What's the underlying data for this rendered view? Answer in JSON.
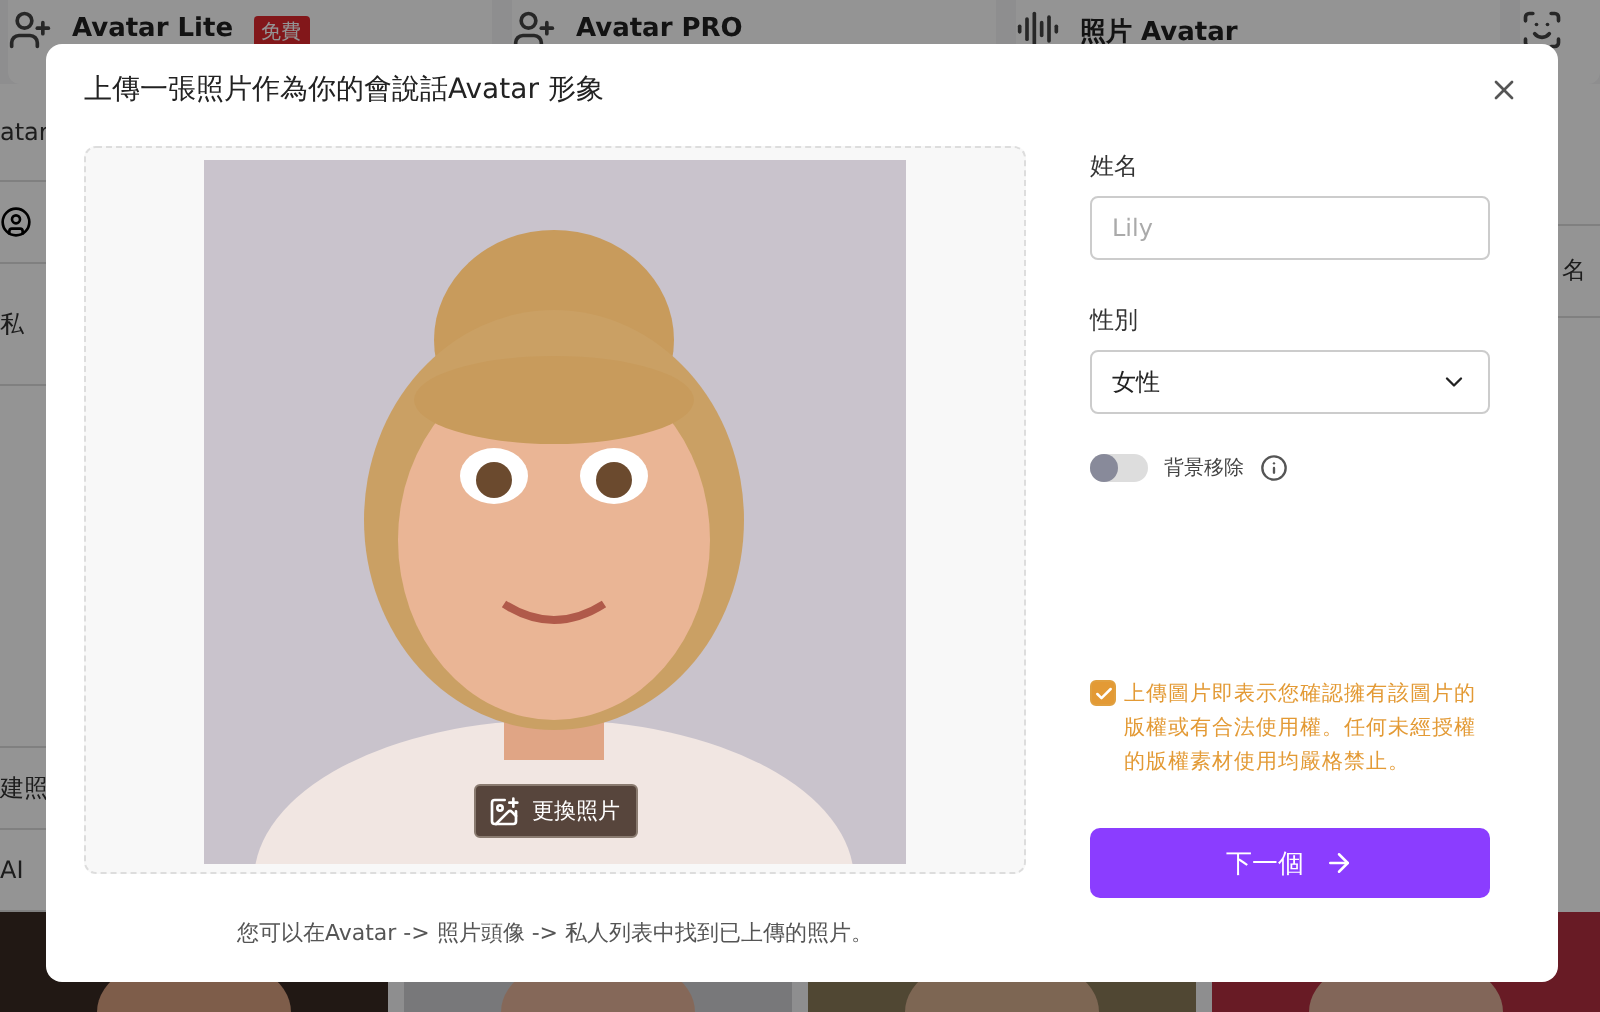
{
  "background": {
    "tabs": [
      {
        "label": "Avatar Lite",
        "badge": "免費"
      },
      {
        "label": "Avatar PRO"
      },
      {
        "label": "照片 Avatar"
      }
    ],
    "side_texts": [
      "atar",
      "私",
      "建照",
      "AI"
    ],
    "right_text": "名"
  },
  "dialog": {
    "title": "上傳一張照片作為你的會說話Avatar 形象",
    "change_photo": "更換照片",
    "hint": "您可以在Avatar -> 照片頭像 -> 私人列表中找到已上傳的照片。",
    "name_label": "姓名",
    "name_placeholder": "Lily",
    "gender_label": "性別",
    "gender_value": "女性",
    "bg_remove": {
      "label": "背景移除",
      "on": false
    },
    "consent": {
      "text": "上傳圖片即表示您確認擁有該圖片的版權或有合法使用權。任何未經授權的版權素材使用均嚴格禁止。",
      "checked": true
    },
    "next_button": "下一個"
  }
}
